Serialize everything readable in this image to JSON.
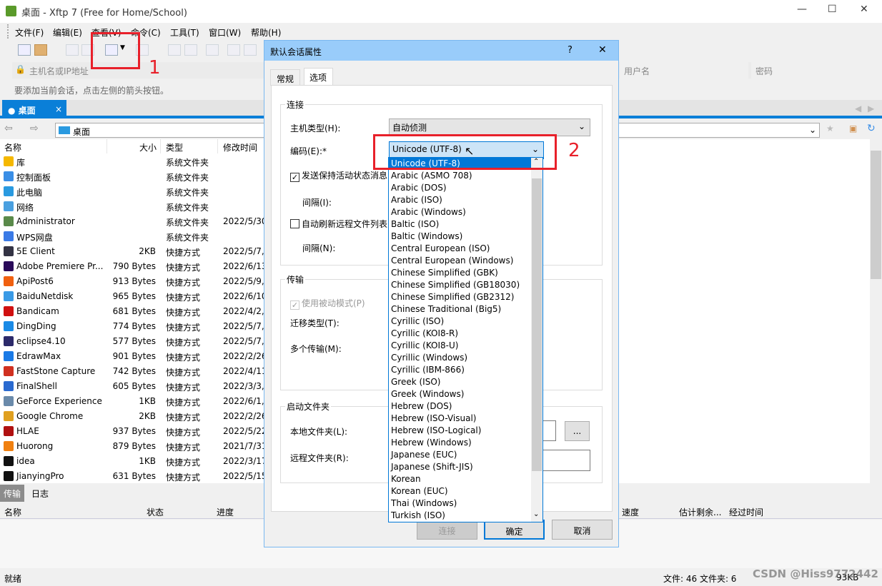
{
  "window": {
    "title": "桌面 - Xftp 7 (Free for Home/School)",
    "minimize": "—",
    "maximize": "☐",
    "close": "✕"
  },
  "menu": [
    "文件(F)",
    "编辑(E)",
    "查看(V)",
    "命令(C)",
    "工具(T)",
    "窗口(W)",
    "帮助(H)"
  ],
  "address": {
    "host_placeholder": "主机名或IP地址",
    "user_placeholder": "用户名",
    "password_placeholder": "密码"
  },
  "hint": "要添加当前会话，点击左侧的箭头按钮。",
  "session_tab": {
    "label": "桌面",
    "close": "×"
  },
  "path": "桌面",
  "columns": [
    "名称",
    "大小",
    "类型",
    "修改时间"
  ],
  "files": [
    {
      "name": "库",
      "size": "",
      "type": "系统文件夹",
      "mtime": "",
      "color": "#f5b800"
    },
    {
      "name": "控制面板",
      "size": "",
      "type": "系统文件夹",
      "mtime": "",
      "color": "#3a8ee6"
    },
    {
      "name": "此电脑",
      "size": "",
      "type": "系统文件夹",
      "mtime": "",
      "color": "#2a9ae0"
    },
    {
      "name": "网络",
      "size": "",
      "type": "系统文件夹",
      "mtime": "",
      "color": "#4aa0e0"
    },
    {
      "name": "Administrator",
      "size": "",
      "type": "系统文件夹",
      "mtime": "2022/5/30",
      "color": "#5a8a4a"
    },
    {
      "name": "WPS网盘",
      "size": "",
      "type": "系统文件夹",
      "mtime": "",
      "color": "#3a7ae6"
    },
    {
      "name": "5E Client",
      "size": "2KB",
      "type": "快捷方式",
      "mtime": "2022/5/7,",
      "color": "#334"
    },
    {
      "name": "Adobe Premiere Pr...",
      "size": "790 Bytes",
      "type": "快捷方式",
      "mtime": "2022/6/13",
      "color": "#2a0a5a"
    },
    {
      "name": "ApiPost6",
      "size": "913 Bytes",
      "type": "快捷方式",
      "mtime": "2022/5/9,",
      "color": "#f06010"
    },
    {
      "name": "BaiduNetdisk",
      "size": "965 Bytes",
      "type": "快捷方式",
      "mtime": "2022/6/10",
      "color": "#3a9ae6"
    },
    {
      "name": "Bandicam",
      "size": "681 Bytes",
      "type": "快捷方式",
      "mtime": "2022/4/2,",
      "color": "#d01010"
    },
    {
      "name": "DingDing",
      "size": "774 Bytes",
      "type": "快捷方式",
      "mtime": "2022/5/7,",
      "color": "#1a8ae6"
    },
    {
      "name": "eclipse4.10",
      "size": "577 Bytes",
      "type": "快捷方式",
      "mtime": "2022/5/7,",
      "color": "#2c2a6a"
    },
    {
      "name": "EdrawMax",
      "size": "901 Bytes",
      "type": "快捷方式",
      "mtime": "2022/2/26",
      "color": "#1a7ae6"
    },
    {
      "name": "FastStone Capture",
      "size": "742 Bytes",
      "type": "快捷方式",
      "mtime": "2022/4/11",
      "color": "#d03020"
    },
    {
      "name": "FinalShell",
      "size": "605 Bytes",
      "type": "快捷方式",
      "mtime": "2022/3/3,",
      "color": "#2a6ad0"
    },
    {
      "name": "GeForce Experience",
      "size": "1KB",
      "type": "快捷方式",
      "mtime": "2022/6/1,",
      "color": "#6a8aaa"
    },
    {
      "name": "Google Chrome",
      "size": "2KB",
      "type": "快捷方式",
      "mtime": "2022/2/26",
      "color": "#e0a020"
    },
    {
      "name": "HLAE",
      "size": "937 Bytes",
      "type": "快捷方式",
      "mtime": "2022/5/22",
      "color": "#b01010"
    },
    {
      "name": "Huorong",
      "size": "879 Bytes",
      "type": "快捷方式",
      "mtime": "2021/7/31",
      "color": "#f08010"
    },
    {
      "name": "idea",
      "size": "1KB",
      "type": "快捷方式",
      "mtime": "2022/3/17",
      "color": "#111"
    },
    {
      "name": "JianyingPro",
      "size": "631 Bytes",
      "type": "快捷方式",
      "mtime": "2022/5/15",
      "color": "#111"
    }
  ],
  "bottom_tabs": [
    "传输",
    "日志"
  ],
  "transfer_columns": [
    "名称",
    "状态",
    "进度",
    "速度",
    "估计剩余...",
    "经过时间"
  ],
  "status": {
    "left": "就绪",
    "files": "文件: 46  文件夹: 6",
    "size": "93KB"
  },
  "dialog": {
    "title": "默认会话属性",
    "help": "?",
    "close": "✕",
    "tabs": [
      "常规",
      "选项"
    ],
    "group_connect": "连接",
    "host_type_label": "主机类型(H):",
    "host_type_value": "自动侦测",
    "encoding_label": "编码(E):*",
    "encoding_value": "Unicode (UTF-8)",
    "keepalive_label": "发送保持活动状态消息(",
    "keepalive_checked": true,
    "interval_i": "间隔(I):",
    "autorefresh_label": "自动刷新远程文件列表(",
    "autorefresh_checked": false,
    "interval_n": "间隔(N):",
    "group_transfer": "传输",
    "passive_label": "使用被动模式(P)",
    "passive_checked": true,
    "migrate_label": "迁移类型(T):",
    "multi_label": "多个传输(M):",
    "group_startup": "启动文件夹",
    "local_label": "本地文件夹(L):",
    "browse": "...",
    "remote_label": "远程文件夹(R):",
    "btn_connect": "连接",
    "btn_ok": "确定",
    "btn_cancel": "取消"
  },
  "encoding_options": [
    "Unicode (UTF-8)",
    "Arabic (ASMO 708)",
    "Arabic (DOS)",
    "Arabic (ISO)",
    "Arabic (Windows)",
    "Baltic (ISO)",
    "Baltic (Windows)",
    "Central European (ISO)",
    "Central European (Windows)",
    "Chinese Simplified (GBK)",
    "Chinese Simplified (GB18030)",
    "Chinese Simplified (GB2312)",
    "Chinese Traditional (Big5)",
    "Cyrillic (ISO)",
    "Cyrillic (KOI8-R)",
    "Cyrillic (KOI8-U)",
    "Cyrillic (Windows)",
    "Cyrillic (IBM-866)",
    "Greek (ISO)",
    "Greek (Windows)",
    "Hebrew (DOS)",
    "Hebrew (ISO-Visual)",
    "Hebrew (ISO-Logical)",
    "Hebrew (Windows)",
    "Japanese (EUC)",
    "Japanese (Shift-JIS)",
    "Korean",
    "Korean (EUC)",
    "Thai (Windows)",
    "Turkish (ISO)"
  ],
  "annotations": {
    "step1": "1",
    "step2": "2",
    "color": "#e8202a"
  },
  "watermark": "CSDN @Hiss9772442"
}
